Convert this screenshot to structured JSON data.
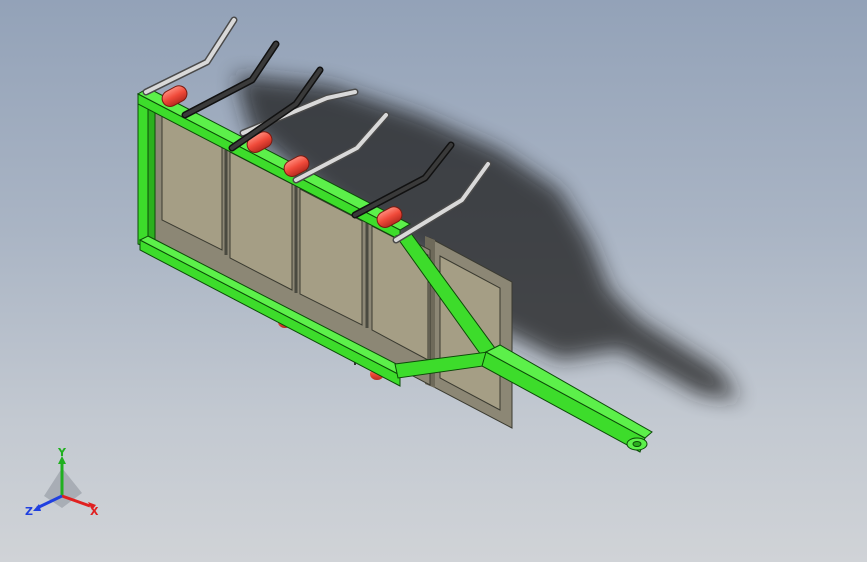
{
  "viewport": {
    "background_top": "#93a2b8",
    "background_bottom": "#d0d3d7"
  },
  "model": {
    "frame_color": "#3ddc2b",
    "panel_color": "#a59e85",
    "roller_color": "#f04a3a",
    "dark_arm_color": "#2d2d2d",
    "light_arm_color": "#cfcfcf"
  },
  "triad": {
    "x_label": "X",
    "y_label": "Y",
    "z_label": "Z",
    "x_color": "#e02020",
    "y_color": "#20b020",
    "z_color": "#2040e0"
  }
}
